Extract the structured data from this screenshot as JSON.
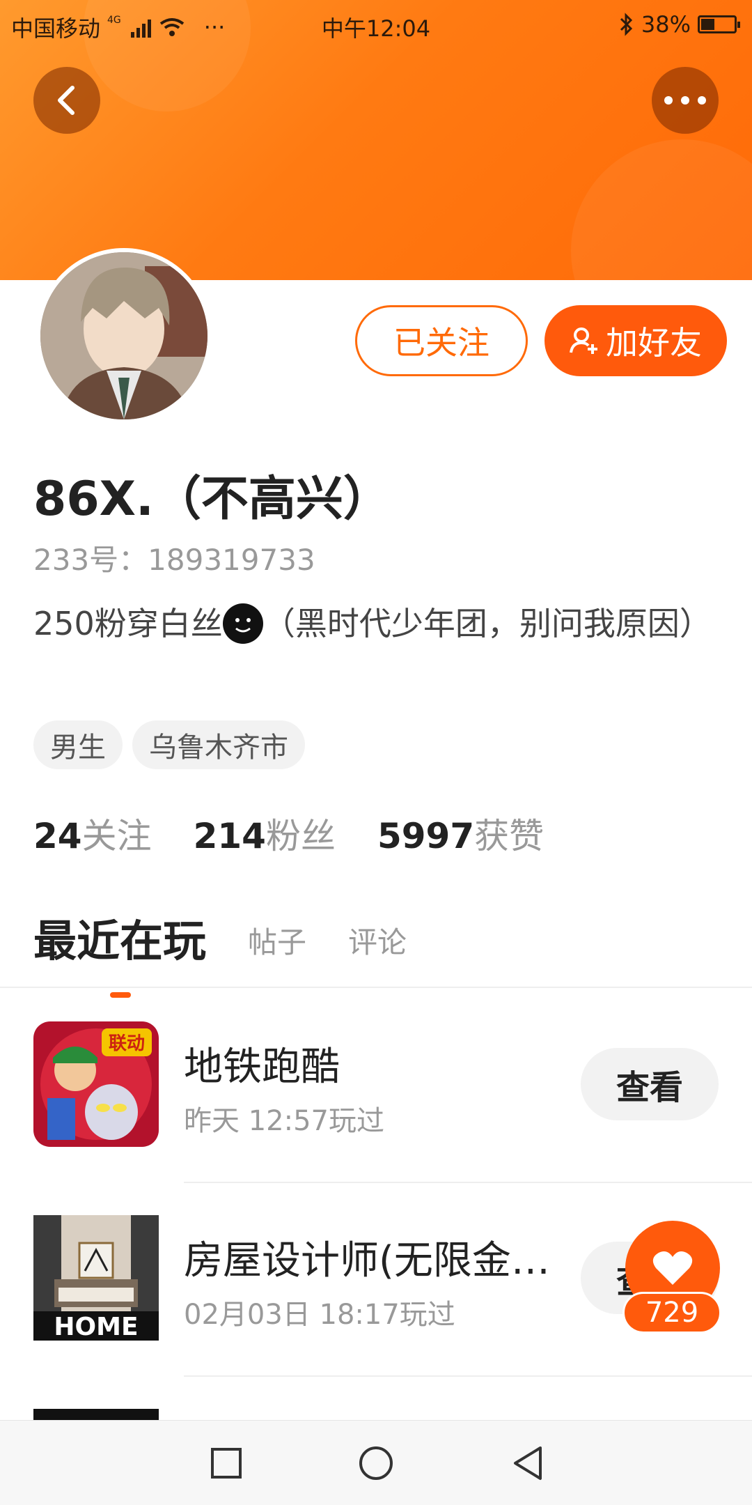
{
  "status_bar": {
    "carrier": "中国移动",
    "network": "4G",
    "time": "中午12:04",
    "battery": "38%",
    "more": "···"
  },
  "profile": {
    "name": "86X.（不高兴）",
    "uid": "233号：189319733",
    "bio_before": "250粉穿白丝",
    "bio_after": "（黑时代少年团，别问我原因）",
    "tags": [
      "男生",
      "乌鲁木齐市"
    ],
    "stats": [
      {
        "num": "24",
        "label": "关注"
      },
      {
        "num": "214",
        "label": "粉丝"
      },
      {
        "num": "5997",
        "label": "获赞"
      }
    ]
  },
  "actions": {
    "followed": "已关注",
    "add_friend": "加好友"
  },
  "tabs": {
    "active": "最近在玩",
    "posts": "帖子",
    "comments": "评论"
  },
  "games": [
    {
      "title": "地铁跑酷",
      "time": "昨天 12:57玩过",
      "button": "查看",
      "badge": "联动"
    },
    {
      "title": "房屋设计师(无限金…",
      "time": "02月03日 18:17玩过",
      "button": "查看",
      "badge": "HOME"
    }
  ],
  "floating_like": {
    "count": "729"
  },
  "colors": {
    "accent": "#ff5a0c",
    "header": "#ff7a12"
  }
}
